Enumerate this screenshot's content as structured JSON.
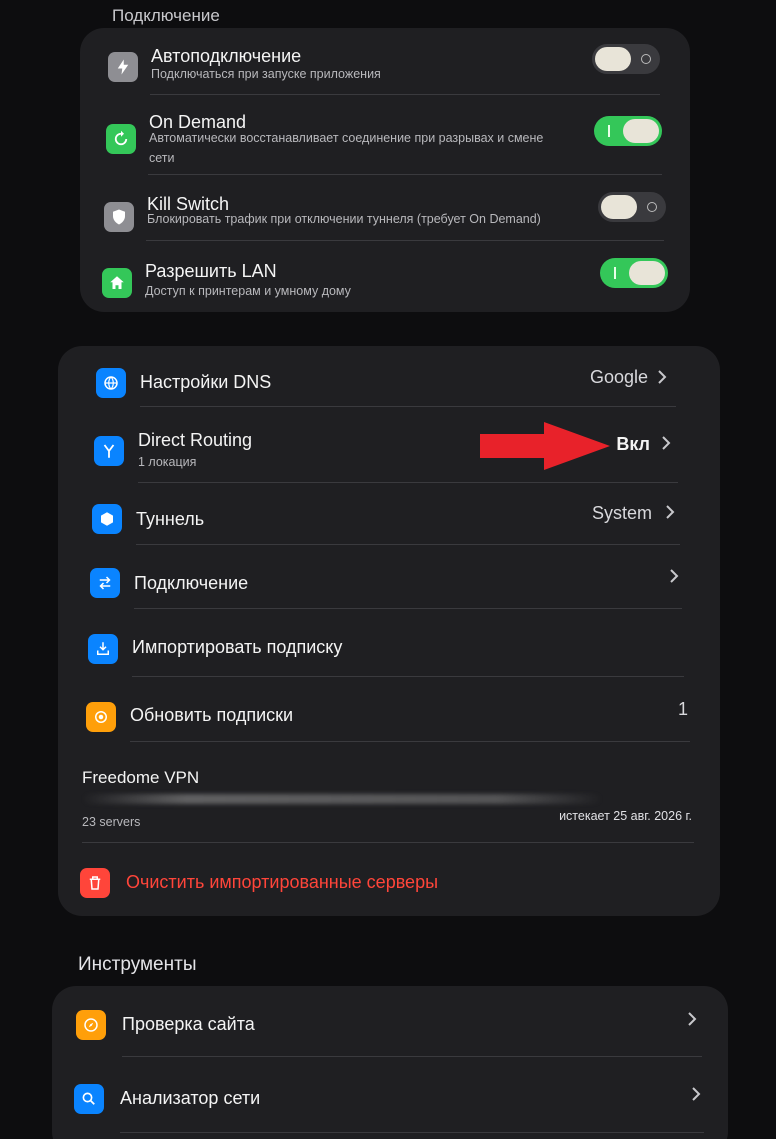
{
  "connection_section": {
    "title": "Подключение",
    "items": [
      {
        "label": "Автоподключение",
        "sub": "Подключаться при запуске приложения",
        "icon": "bolt-icon",
        "toggle": "off"
      },
      {
        "label": "On Demand",
        "sub1": "Автоматически восстанавливает соединение при разрывах и смене",
        "sub2": "сети",
        "icon": "refresh-icon",
        "toggle": "on"
      },
      {
        "label": "Kill Switch",
        "sub": "Блокировать трафик при отключении туннеля (требует On Demand)",
        "icon": "shield-icon",
        "toggle": "off"
      },
      {
        "label": "Разрешить LAN",
        "sub": "Доступ к принтерам и умному дому",
        "icon": "home-icon",
        "toggle": "on"
      }
    ]
  },
  "settings_section": {
    "items": [
      {
        "label": "Настройки DNS",
        "value": "Google",
        "icon": "globe-icon"
      },
      {
        "label": "Direct Routing",
        "sub": "1 локация",
        "value": "Вкл",
        "icon": "routing-icon"
      },
      {
        "label": "Туннель",
        "value": "System",
        "icon": "hexagon-icon"
      },
      {
        "label": "Подключение",
        "value": "",
        "icon": "swap-icon"
      },
      {
        "label": "Импортировать подписку",
        "value": "",
        "icon": "download-icon"
      },
      {
        "label": "Обновить подписки",
        "value": "1",
        "icon": "update-icon"
      }
    ],
    "subscription": {
      "name": "Freedome VPN",
      "servers": "23 servers",
      "expires": "истекает 25 авг. 2026 г."
    },
    "clear_label": "Очистить импортированные серверы"
  },
  "tools_section": {
    "title": "Инструменты",
    "items": [
      {
        "label": "Проверка сайта",
        "icon": "compass-icon"
      },
      {
        "label": "Анализатор сети",
        "icon": "search-icon"
      }
    ]
  },
  "colors": {
    "green": "#34c759",
    "blue": "#0a84ff",
    "orange": "#ff9f0a",
    "red": "#ff453a",
    "annotation_arrow": "#e8222a"
  }
}
